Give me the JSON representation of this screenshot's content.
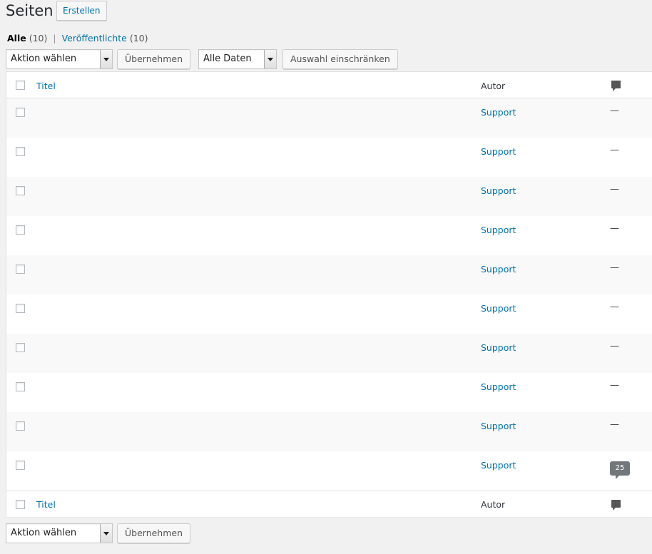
{
  "header": {
    "title": "Seiten",
    "add_new": "Erstellen"
  },
  "views": [
    {
      "label": "Alle",
      "count": "(10)"
    },
    {
      "label": "Veröffentlichte",
      "count": "(10)"
    }
  ],
  "views_separator": "|",
  "top_nav": {
    "bulk_action": "Aktion wählen",
    "apply": "Übernehmen",
    "date_filter": "Alle Daten",
    "filter": "Auswahl einschränken"
  },
  "bottom_nav": {
    "bulk_action": "Aktion wählen",
    "apply": "Übernehmen"
  },
  "columns": {
    "title": "Titel",
    "author": "Autor",
    "comments_icon": "comment-icon"
  },
  "rows": [
    {
      "author": "Support",
      "comments": "—"
    },
    {
      "author": "Support",
      "comments": "—"
    },
    {
      "author": "Support",
      "comments": "—"
    },
    {
      "author": "Support",
      "comments": "—"
    },
    {
      "author": "Support",
      "comments": "—"
    },
    {
      "author": "Support",
      "comments": "—"
    },
    {
      "author": "Support",
      "comments": "—"
    },
    {
      "author": "Support",
      "comments": "—"
    },
    {
      "author": "Support",
      "comments": "—"
    },
    {
      "author": "Support",
      "comments": "25"
    }
  ],
  "colors": {
    "link": "#0073aa",
    "background": "#f1f1f1",
    "bubble": "#72777c"
  }
}
